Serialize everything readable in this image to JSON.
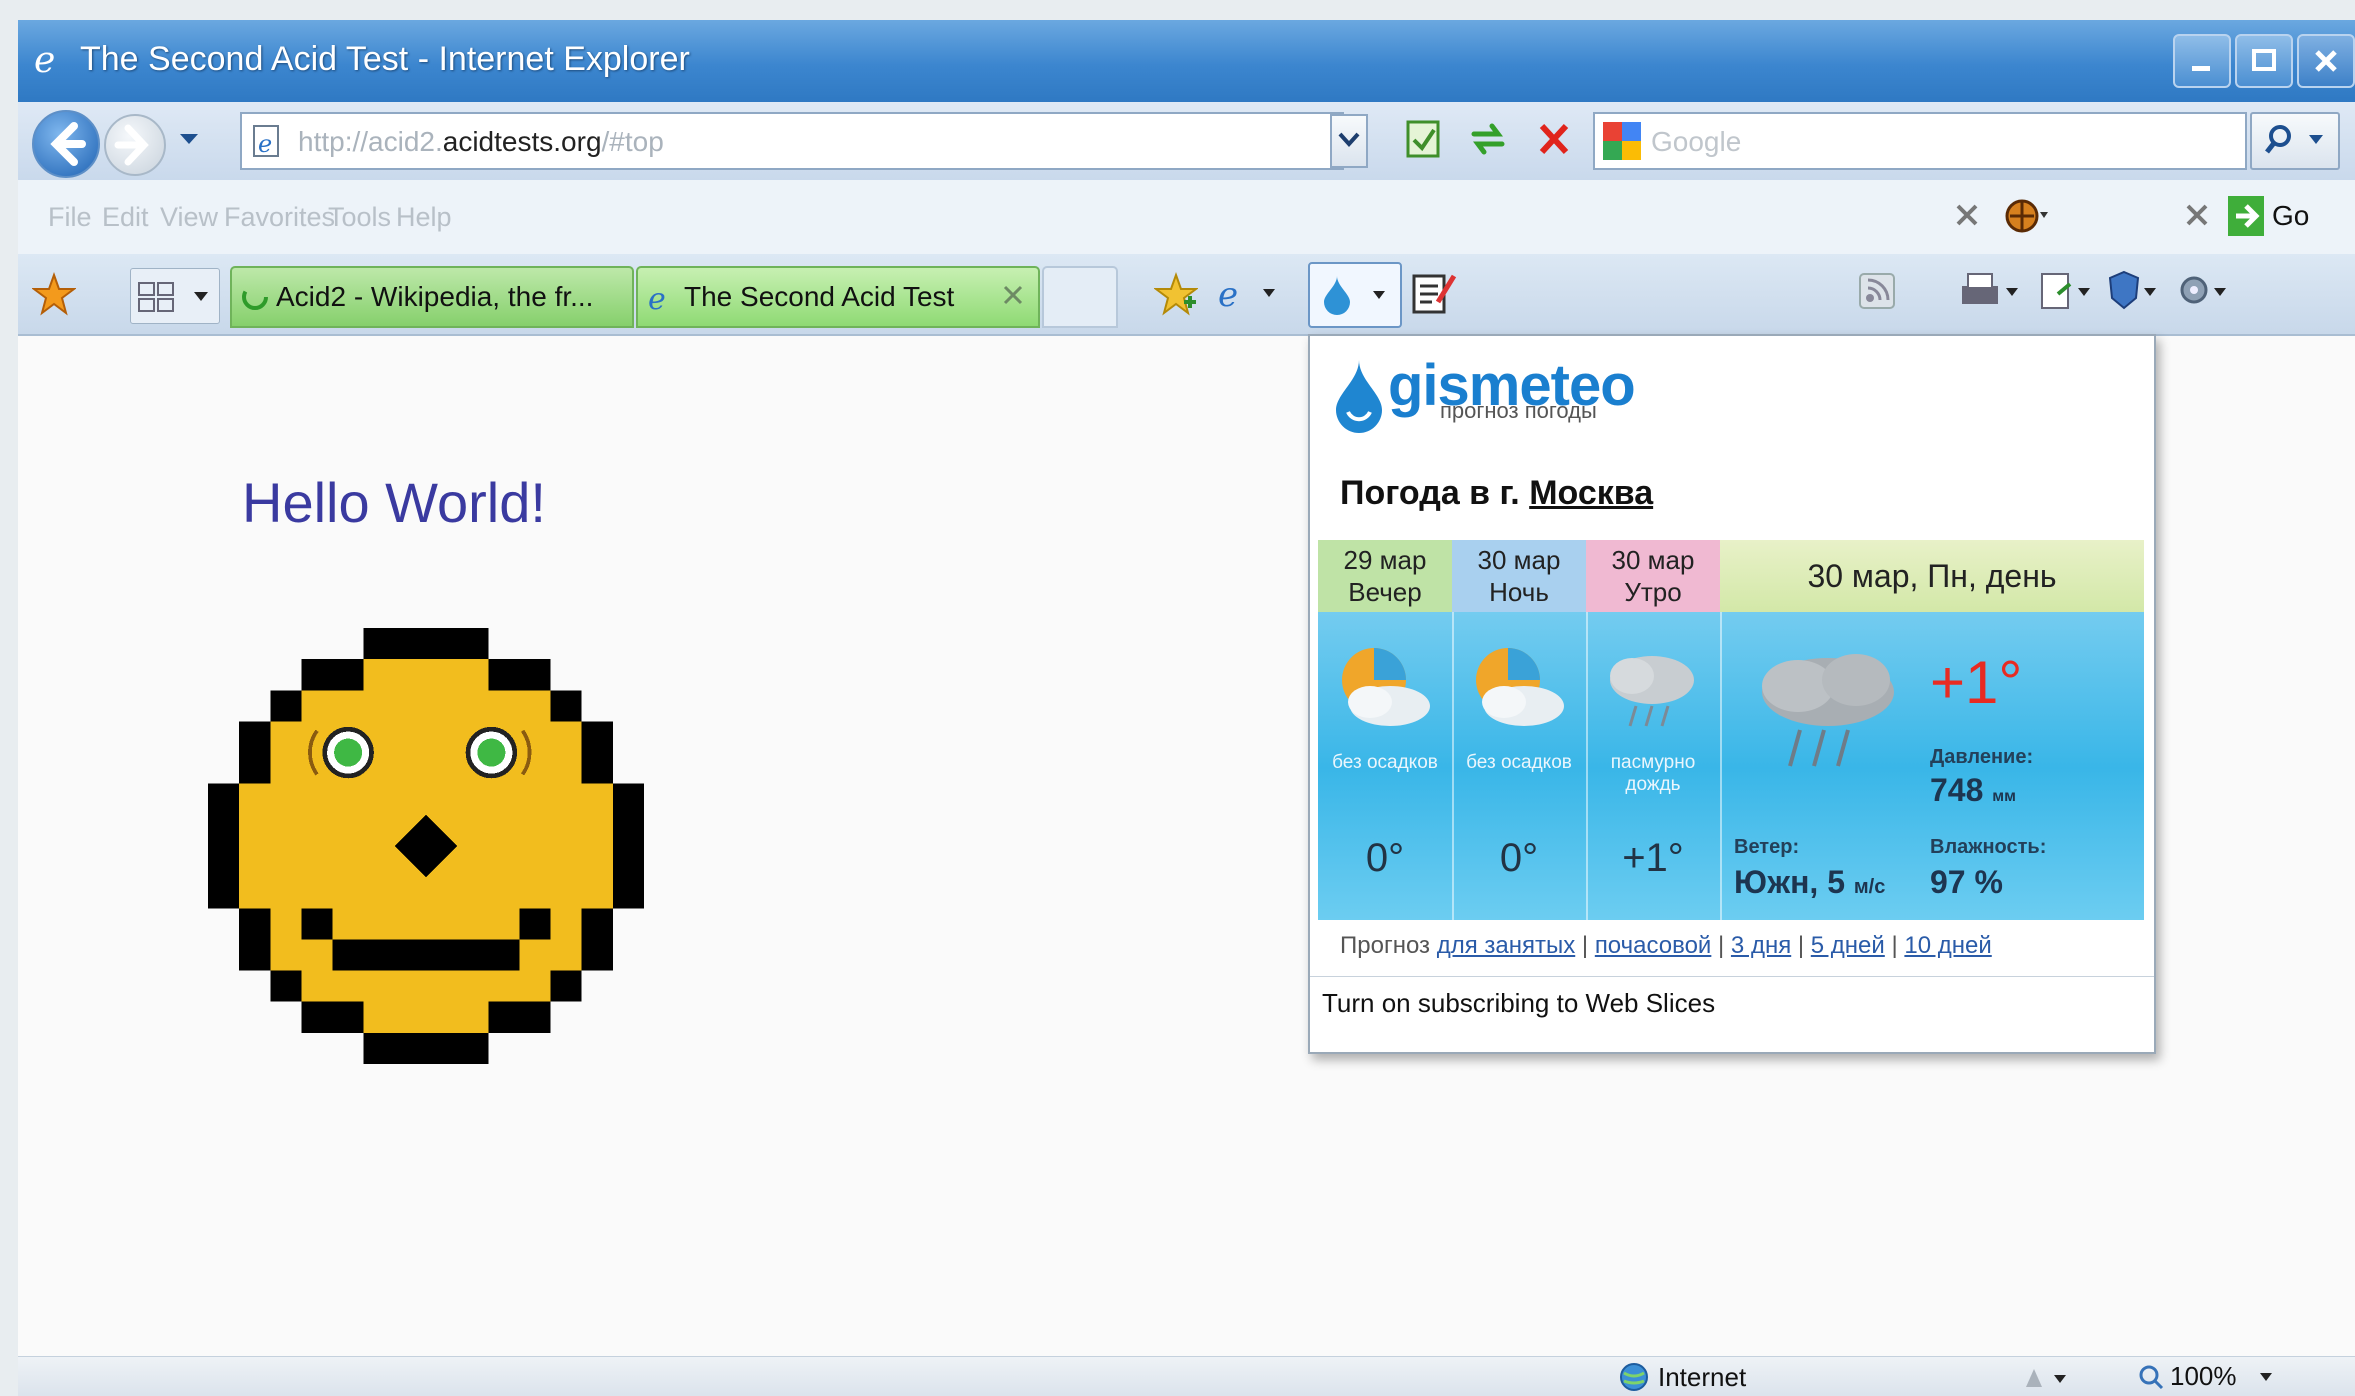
{
  "window": {
    "title": "The Second Acid Test - Internet Explorer"
  },
  "address_bar": {
    "url_prefix": "http://acid2.",
    "url_domain": "acidtests.org",
    "url_suffix": "/#top",
    "search_placeholder": "Google"
  },
  "menu": {
    "items": [
      "File",
      "Edit",
      "View",
      "Favorites",
      "Tools",
      "Help"
    ],
    "go_label": "Go"
  },
  "tabs": [
    {
      "label": "Acid2 - Wikipedia, the fr..."
    },
    {
      "label": "The Second Acid Test"
    }
  ],
  "page": {
    "heading": "Hello World!"
  },
  "weather_popup": {
    "brand": "gismeteo",
    "brand_sub": "прогноз погоды",
    "title_prefix": "Погода в г. ",
    "city": "Москва",
    "columns": [
      {
        "date": "29 мар",
        "period": "Вечер",
        "desc": "без осадков",
        "temp": "0°",
        "head_color": "#bfe3a6"
      },
      {
        "date": "30 мар",
        "period": "Ночь",
        "desc": "без осадков",
        "temp": "0°",
        "head_color": "#a9d0ef"
      },
      {
        "date": "30 мар",
        "period": "Утро",
        "desc": "пасмурно дождь",
        "temp": "+1°",
        "head_color": "#f0b9d2"
      }
    ],
    "current": {
      "heading": "30 мар, Пн, день",
      "temp": "+1°",
      "pressure_label": "Давление:",
      "pressure_value": "748",
      "pressure_unit": "мм",
      "wind_label": "Ветер:",
      "wind_value": "Южн, 5",
      "wind_unit": "м/с",
      "humidity_label": "Влажность:",
      "humidity_value": "97 %"
    },
    "forecast_prefix": "Прогноз",
    "forecast_links": [
      "для занятых",
      "почасовой",
      "3 дня",
      "5 дней",
      "10 дней"
    ],
    "subscribe_text": "Turn on subscribing to Web Slices"
  },
  "statusbar": {
    "zone": "Internet",
    "zoom": "100%"
  }
}
